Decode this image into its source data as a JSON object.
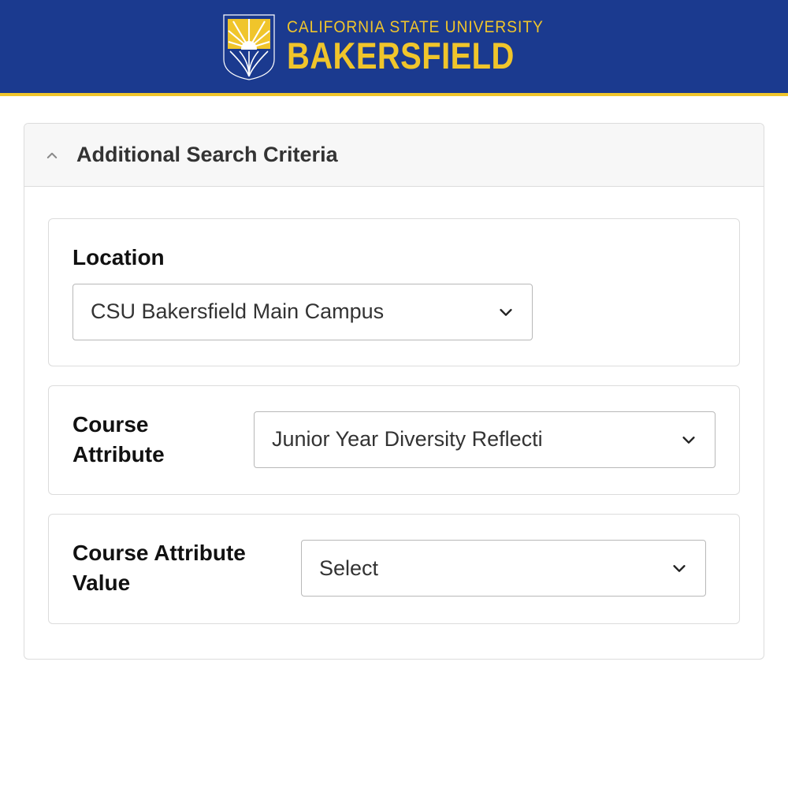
{
  "header": {
    "line1": "CALIFORNIA STATE UNIVERSITY",
    "line2": "BAKERSFIELD"
  },
  "panel": {
    "title": "Additional Search Criteria"
  },
  "fields": {
    "location": {
      "label": "Location",
      "value": "CSU Bakersfield Main Campus"
    },
    "course_attribute": {
      "label": "Course Attribute",
      "value": "Junior Year Diversity Reflecti"
    },
    "course_attribute_value": {
      "label": "Course Attribute Value",
      "value": "Select"
    }
  }
}
